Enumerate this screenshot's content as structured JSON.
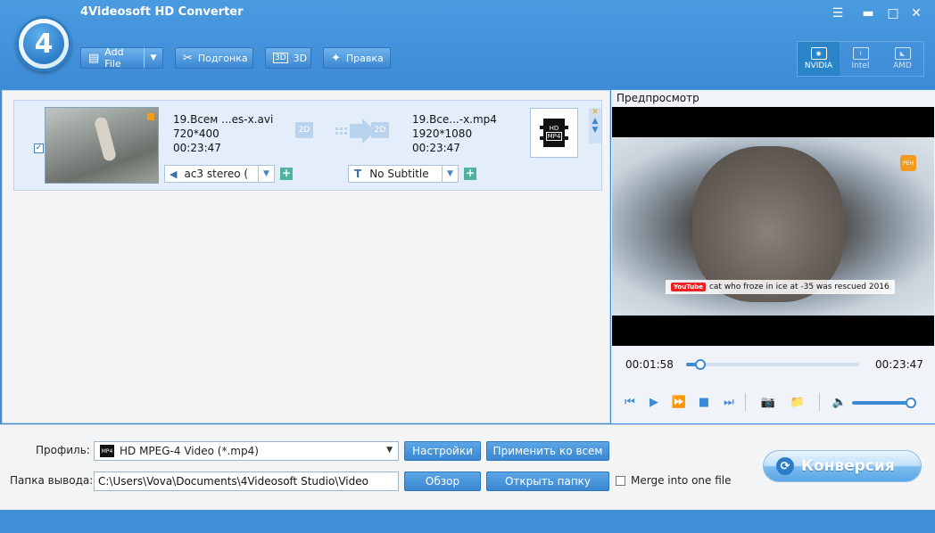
{
  "app": {
    "title": "4Videosoft HD Converter",
    "logo_text": "4"
  },
  "window_controls": {
    "menu_icon": "menu-icon",
    "minimize": "▬",
    "maximize": "□",
    "close": "✕"
  },
  "toolbar": {
    "add_file_label": "Add File",
    "clip_label": "Подгонка",
    "threed_label": "3D",
    "edit_label": "Правка"
  },
  "gpu": {
    "nvidia": "NVIDIA",
    "intel": "Intel",
    "amd": "AMD"
  },
  "file_item": {
    "src_name": "19.Всем ...es-x.avi",
    "src_res": "720*400",
    "src_duration": "00:23:47",
    "dst_name": "19.Все...-x.mp4",
    "dst_res": "1920*1080",
    "dst_duration": "00:23:47",
    "tag_2d_left": "2D",
    "tag_2d_right": "2D",
    "audio_track": "ac3 stereo (",
    "subtitle": "No Subtitle",
    "format_badge_top": "HD",
    "format_badge_bottom": "MP4",
    "checked": true
  },
  "preview": {
    "title": "Предпросмотр",
    "caption": "cat who froze in ice at -35 was rescued 2016",
    "youtube_label": "YouTube",
    "badge": "РЕН",
    "time_current": "00:01:58",
    "time_total": "00:23:47",
    "progress_fraction": 0.08,
    "volume_fraction": 1.0
  },
  "bottom": {
    "profile_label": "Профиль:",
    "profile_value": "HD MPEG-4 Video (*.mp4)",
    "profile_icon_text": "MP4",
    "settings_button": "Настройки",
    "apply_all_button": "Применить ко всем",
    "output_label": "Папка вывода:",
    "output_path": "C:\\Users\\Vova\\Documents\\4Videosoft Studio\\Video",
    "browse_button": "Обзор",
    "open_folder_button": "Открыть папку",
    "merge_label": "Merge into one file",
    "convert_button": "Конверсия"
  },
  "colors": {
    "accent": "#3d8ad6",
    "topbar": "#4a9be0",
    "row_bg": "#e3eefa"
  }
}
